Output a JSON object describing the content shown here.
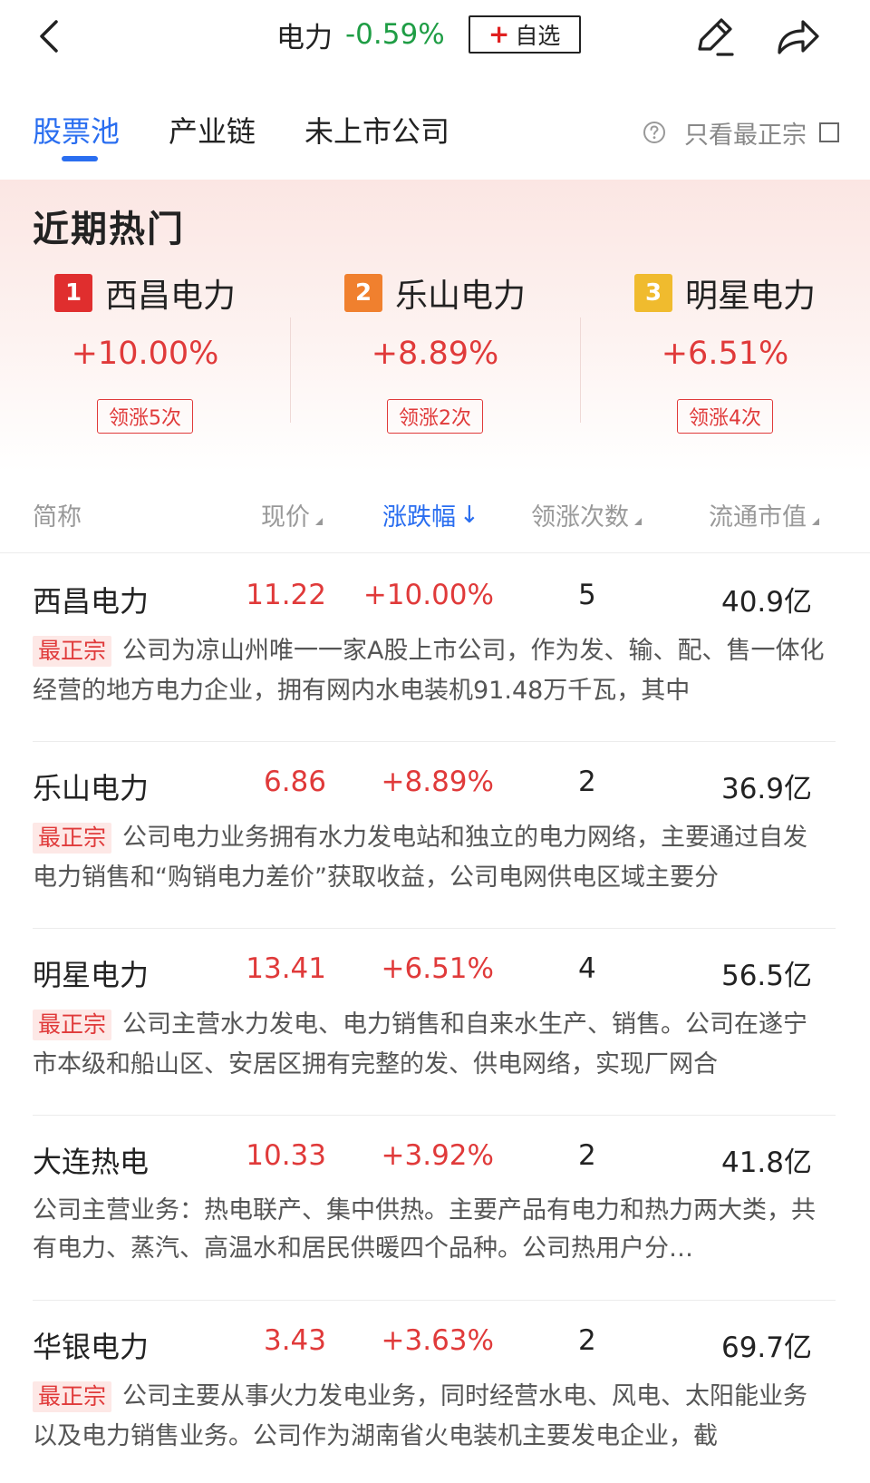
{
  "header": {
    "title": "电力",
    "change_pct": "-0.59%",
    "watch_plus": "+",
    "watch_label": "自选"
  },
  "tabs": [
    {
      "label": "股票池",
      "active": true
    },
    {
      "label": "产业链",
      "active": false
    },
    {
      "label": "未上市公司",
      "active": false
    }
  ],
  "filter": {
    "label": "只看最正宗",
    "checked": false
  },
  "hot": {
    "title": "近期热门",
    "items": [
      {
        "rank": "1",
        "rank_color": "#e02e2e",
        "name": "西昌电力",
        "pct": "+10.00%",
        "badge": "领涨5次"
      },
      {
        "rank": "2",
        "rank_color": "#f0802e",
        "name": "乐山电力",
        "pct": "+8.89%",
        "badge": "领涨2次"
      },
      {
        "rank": "3",
        "rank_color": "#f0bb2e",
        "name": "明星电力",
        "pct": "+6.51%",
        "badge": "领涨4次"
      }
    ]
  },
  "table": {
    "columns": {
      "name": "简称",
      "price": "现价",
      "pct": "涨跌幅",
      "pct_arrow": "↓",
      "times": "领涨次数",
      "cap": "流通市值"
    },
    "rows": [
      {
        "name": "西昌电力",
        "price": "11.22",
        "pct": "+10.00%",
        "times": "5",
        "cap": "40.9亿",
        "tag": "最正宗",
        "desc": "公司为凉山州唯一一家A股上市公司，作为发、输、配、售一体化经营的地方电力企业，拥有网内水电装机91.48万千瓦，其中"
      },
      {
        "name": "乐山电力",
        "price": "6.86",
        "pct": "+8.89%",
        "times": "2",
        "cap": "36.9亿",
        "tag": "最正宗",
        "desc": "公司电力业务拥有水力发电站和独立的电力网络，主要通过自发电力销售和“购销电力差价”获取收益，公司电网供电区域主要分"
      },
      {
        "name": "明星电力",
        "price": "13.41",
        "pct": "+6.51%",
        "times": "4",
        "cap": "56.5亿",
        "tag": "最正宗",
        "desc": "公司主营水力发电、电力销售和自来水生产、销售。公司在遂宁市本级和船山区、安居区拥有完整的发、供电网络，实现厂网合"
      },
      {
        "name": "大连热电",
        "price": "10.33",
        "pct": "+3.92%",
        "times": "2",
        "cap": "41.8亿",
        "tag": "",
        "desc": "公司主营业务：热电联产、集中供热。主要产品有电力和热力两大类，共有电力、蒸汽、高温水和居民供暖四个品种。公司热用户分…"
      },
      {
        "name": "华银电力",
        "price": "3.43",
        "pct": "+3.63%",
        "times": "2",
        "cap": "69.7亿",
        "tag": "最正宗",
        "desc": "公司主要从事火力发电业务，同时经营水电、风电、太阳能业务以及电力销售业务。公司作为湖南省火电装机主要发电企业，截"
      }
    ]
  }
}
